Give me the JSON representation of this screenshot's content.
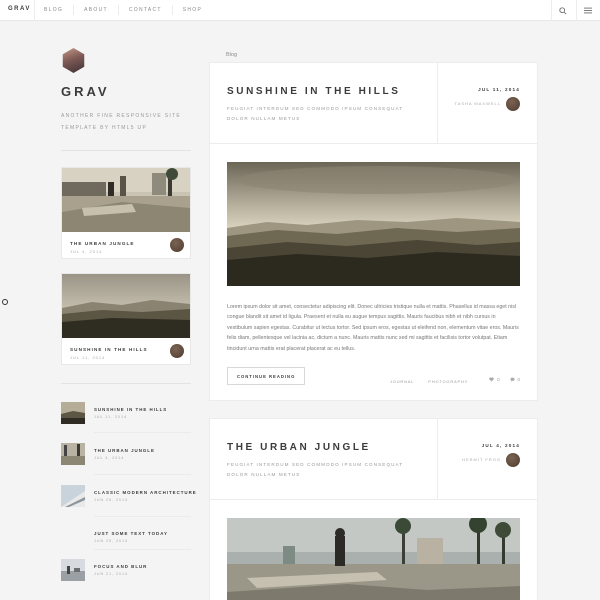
{
  "nav": {
    "brand": "GRAV",
    "links": [
      "BLOG",
      "ABOUT",
      "CONTACT",
      "SHOP"
    ]
  },
  "sidebar": {
    "title": "GRAV",
    "tagline": "ANOTHER FINE RESPONSIVE SITE TEMPLATE BY HTML5 UP",
    "cards": [
      {
        "title": "THE URBAN JUNGLE",
        "date": "JUL 4, 2014"
      },
      {
        "title": "SUNSHINE IN THE HILLS",
        "date": "JUL 11, 2014"
      }
    ],
    "list": [
      {
        "title": "SUNSHINE IN THE HILLS",
        "date": "JUL 11, 2014"
      },
      {
        "title": "THE URBAN JUNGLE",
        "date": "JUL 4, 2014"
      },
      {
        "title": "CLASSIC MODERN ARCHITECTURE",
        "date": "JUN 26, 2014"
      },
      {
        "title": "JUST SOME TEXT TODAY",
        "date": "JUN 25, 2014"
      },
      {
        "title": "FOCUS AND BLUR",
        "date": "JUN 21, 2014"
      }
    ]
  },
  "main": {
    "breadcrumb": "Blog",
    "posts": [
      {
        "title": "SUNSHINE IN THE HILLS",
        "subtitle": "FEUGIAT INTERDUM SED COMMODO IPSUM CONSEQUAT DOLOR NULLAM METUS",
        "date": "JUL 11, 2014",
        "author": "TASHA MAXWELL",
        "body": "Lorem ipsum dolor sit amet, consectetur adipiscing elit. Donec ultricies tristique nulla et mattis. Phasellus id massa eget nisl congue blandit sit amet id ligula. Praesent et nulla eu augue tempus sagittis. Mauris faucibus nibh et nibh cursus in vestibulum sapien egestas. Curabitur ut lectus tortor. Sed ipsum eros, egestas ut eleifend non, elementum vitae eros. Mauris felis diam, pellentesque vel lacinia ac, dictum a nunc. Mauris mattis nunc sed mi sagittis et facilisis tortor volutpat. Etiam tincidunt urna mattis erat placerat placerat ac eu tellus.",
        "button": "CONTINUE READING",
        "tags": [
          "JOURNAL",
          "PHOTOGRAPHY"
        ],
        "likes": "0",
        "comments": "0"
      },
      {
        "title": "THE URBAN JUNGLE",
        "subtitle": "FEUGIAT INTERDUM SED COMMODO IPSUM CONSEQUAT DOLOR NULLAM METUS",
        "date": "JUL 4, 2014",
        "author": "HERMIT FROG"
      }
    ]
  }
}
